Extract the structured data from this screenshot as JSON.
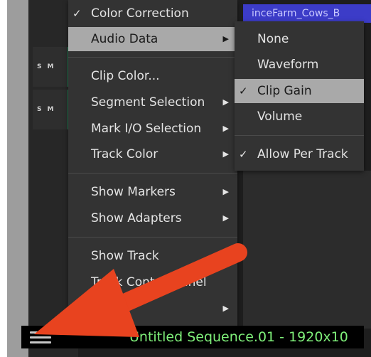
{
  "sequence_title_bar": "inceFarm_Cows_B",
  "tracks": [
    {
      "solo": "S",
      "mute": "M"
    },
    {
      "solo": "S",
      "mute": "M"
    }
  ],
  "main_menu": {
    "color_correction": "Color Correction",
    "audio_data": "Audio Data",
    "clip_color": "Clip Color...",
    "segment_selection": "Segment Selection",
    "mark_io_selection": "Mark I/O Selection",
    "track_color": "Track Color",
    "show_markers": "Show Markers",
    "show_adapters": "Show Adapters",
    "show_track": "Show Track",
    "track_control_panel": "Track Control Panel",
    "partial_item": "...m"
  },
  "audio_submenu": {
    "none": "None",
    "waveform": "Waveform",
    "clip_gain": "Clip Gain",
    "volume": "Volume",
    "allow_per_track": "Allow Per Track"
  },
  "glyphs": {
    "check": "✓",
    "arrow": "▶"
  },
  "bottom_bar": {
    "sequence_name": "Untitled Sequence.01 - 1920x10"
  },
  "colors": {
    "menu_bg": "#333333",
    "highlight": "#a9a9a9",
    "sequence_text": "#7ff07a",
    "annotation_arrow": "#e8431f"
  }
}
